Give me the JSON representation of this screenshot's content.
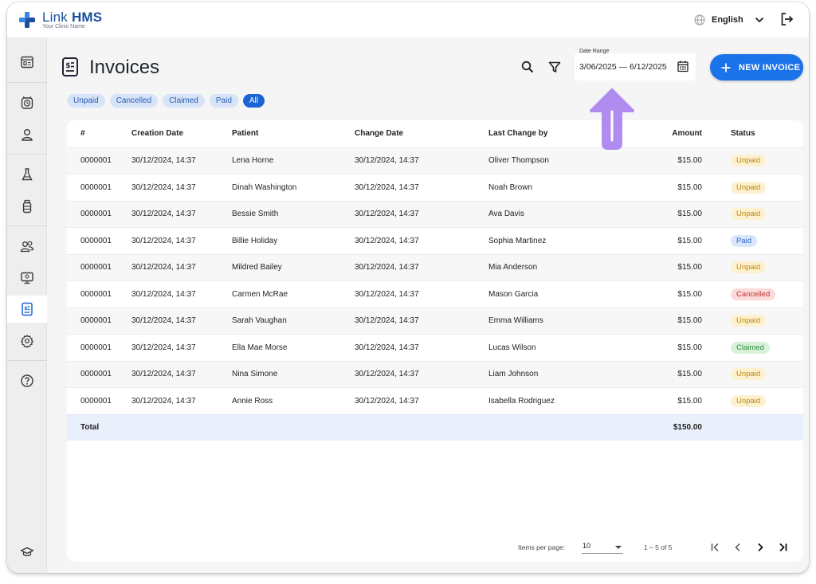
{
  "app": {
    "brand_light": "Link",
    "brand_bold": "HMS",
    "clinic_name": "Your Clinic Name"
  },
  "header": {
    "language": "English",
    "globe_icon": "globe-icon",
    "logout_icon": "logout-icon"
  },
  "sidebar": {
    "items": [
      {
        "name": "dashboard",
        "icon": "dashboard-icon",
        "active": false
      },
      {
        "name": "appointments",
        "icon": "alarm-clock-icon",
        "active": false
      },
      {
        "name": "patients",
        "icon": "person-icon",
        "active": false
      },
      {
        "name": "lab",
        "icon": "flask-icon",
        "active": false
      },
      {
        "name": "pharmacy",
        "icon": "medicine-bottle-icon",
        "active": false
      },
      {
        "name": "staff",
        "icon": "group-icon",
        "active": false
      },
      {
        "name": "monitor",
        "icon": "monitor-icon",
        "active": false
      },
      {
        "name": "invoices",
        "icon": "invoice-icon",
        "active": true
      },
      {
        "name": "settings",
        "icon": "gear-icon",
        "active": false
      },
      {
        "name": "help",
        "icon": "help-icon",
        "active": false
      },
      {
        "name": "training",
        "icon": "graduation-cap-icon",
        "active": false
      }
    ]
  },
  "page": {
    "title": "Invoices"
  },
  "toolbar": {
    "date_range_label": "Date Range",
    "date_range_value": "3/06/2025 — 6/12/2025",
    "new_invoice_label": "NEW INVOICE"
  },
  "filters": [
    {
      "label": "Unpaid",
      "selected": false
    },
    {
      "label": "Cancelled",
      "selected": false
    },
    {
      "label": "Claimed",
      "selected": false
    },
    {
      "label": "Paid",
      "selected": false
    },
    {
      "label": "All",
      "selected": true
    }
  ],
  "table": {
    "columns": [
      "#",
      "Creation Date",
      "Patient",
      "Change Date",
      "Last Change by",
      "Amount",
      "Status"
    ],
    "rows": [
      {
        "id": "0000001",
        "created": "30/12/2024, 14:37",
        "patient": "Lena Horne",
        "changed": "30/12/2024, 14:37",
        "by": "Oliver Thompson",
        "amount": "$15.00",
        "status": "Unpaid"
      },
      {
        "id": "0000001",
        "created": "30/12/2024, 14:37",
        "patient": "Dinah Washington",
        "changed": "30/12/2024, 14:37",
        "by": "Noah Brown",
        "amount": "$15.00",
        "status": "Unpaid"
      },
      {
        "id": "0000001",
        "created": "30/12/2024, 14:37",
        "patient": "Bessie Smith",
        "changed": "30/12/2024, 14:37",
        "by": "Ava Davis",
        "amount": "$15.00",
        "status": "Unpaid"
      },
      {
        "id": "0000001",
        "created": "30/12/2024, 14:37",
        "patient": "Billie Holiday",
        "changed": "30/12/2024, 14:37",
        "by": "Sophia Martinez",
        "amount": "$15.00",
        "status": "Paid"
      },
      {
        "id": "0000001",
        "created": "30/12/2024, 14:37",
        "patient": "Mildred Bailey",
        "changed": "30/12/2024, 14:37",
        "by": "Mia Anderson",
        "amount": "$15.00",
        "status": "Unpaid"
      },
      {
        "id": "0000001",
        "created": "30/12/2024, 14:37",
        "patient": "Carmen McRae",
        "changed": "30/12/2024, 14:37",
        "by": "Mason Garcia",
        "amount": "$15.00",
        "status": "Cancelled"
      },
      {
        "id": "0000001",
        "created": "30/12/2024, 14:37",
        "patient": "Sarah Vaughan",
        "changed": "30/12/2024, 14:37",
        "by": "Emma Williams",
        "amount": "$15.00",
        "status": "Unpaid"
      },
      {
        "id": "0000001",
        "created": "30/12/2024, 14:37",
        "patient": "Ella Mae Morse",
        "changed": "30/12/2024, 14:37",
        "by": "Lucas Wilson",
        "amount": "$15.00",
        "status": "Claimed"
      },
      {
        "id": "0000001",
        "created": "30/12/2024, 14:37",
        "patient": "Nina Simone",
        "changed": "30/12/2024, 14:37",
        "by": "Liam Johnson",
        "amount": "$15.00",
        "status": "Unpaid"
      },
      {
        "id": "0000001",
        "created": "30/12/2024, 14:37",
        "patient": "Annie Ross",
        "changed": "30/12/2024, 14:37",
        "by": "Isabella Rodriguez",
        "amount": "$15.00",
        "status": "Unpaid"
      }
    ],
    "total_label": "Total",
    "total_amount": "$150.00"
  },
  "pagination": {
    "items_per_page_label": "Items per page:",
    "items_per_page_value": "10",
    "range_text": "1 – 5 of 5"
  },
  "colors": {
    "primary": "#1a73e8",
    "brand": "#1b4f9c",
    "annotation_arrow": "#b18cf0",
    "unpaid": "#b88a12",
    "paid": "#2f66c9",
    "cancelled": "#c23434",
    "claimed": "#2f8a3c"
  }
}
